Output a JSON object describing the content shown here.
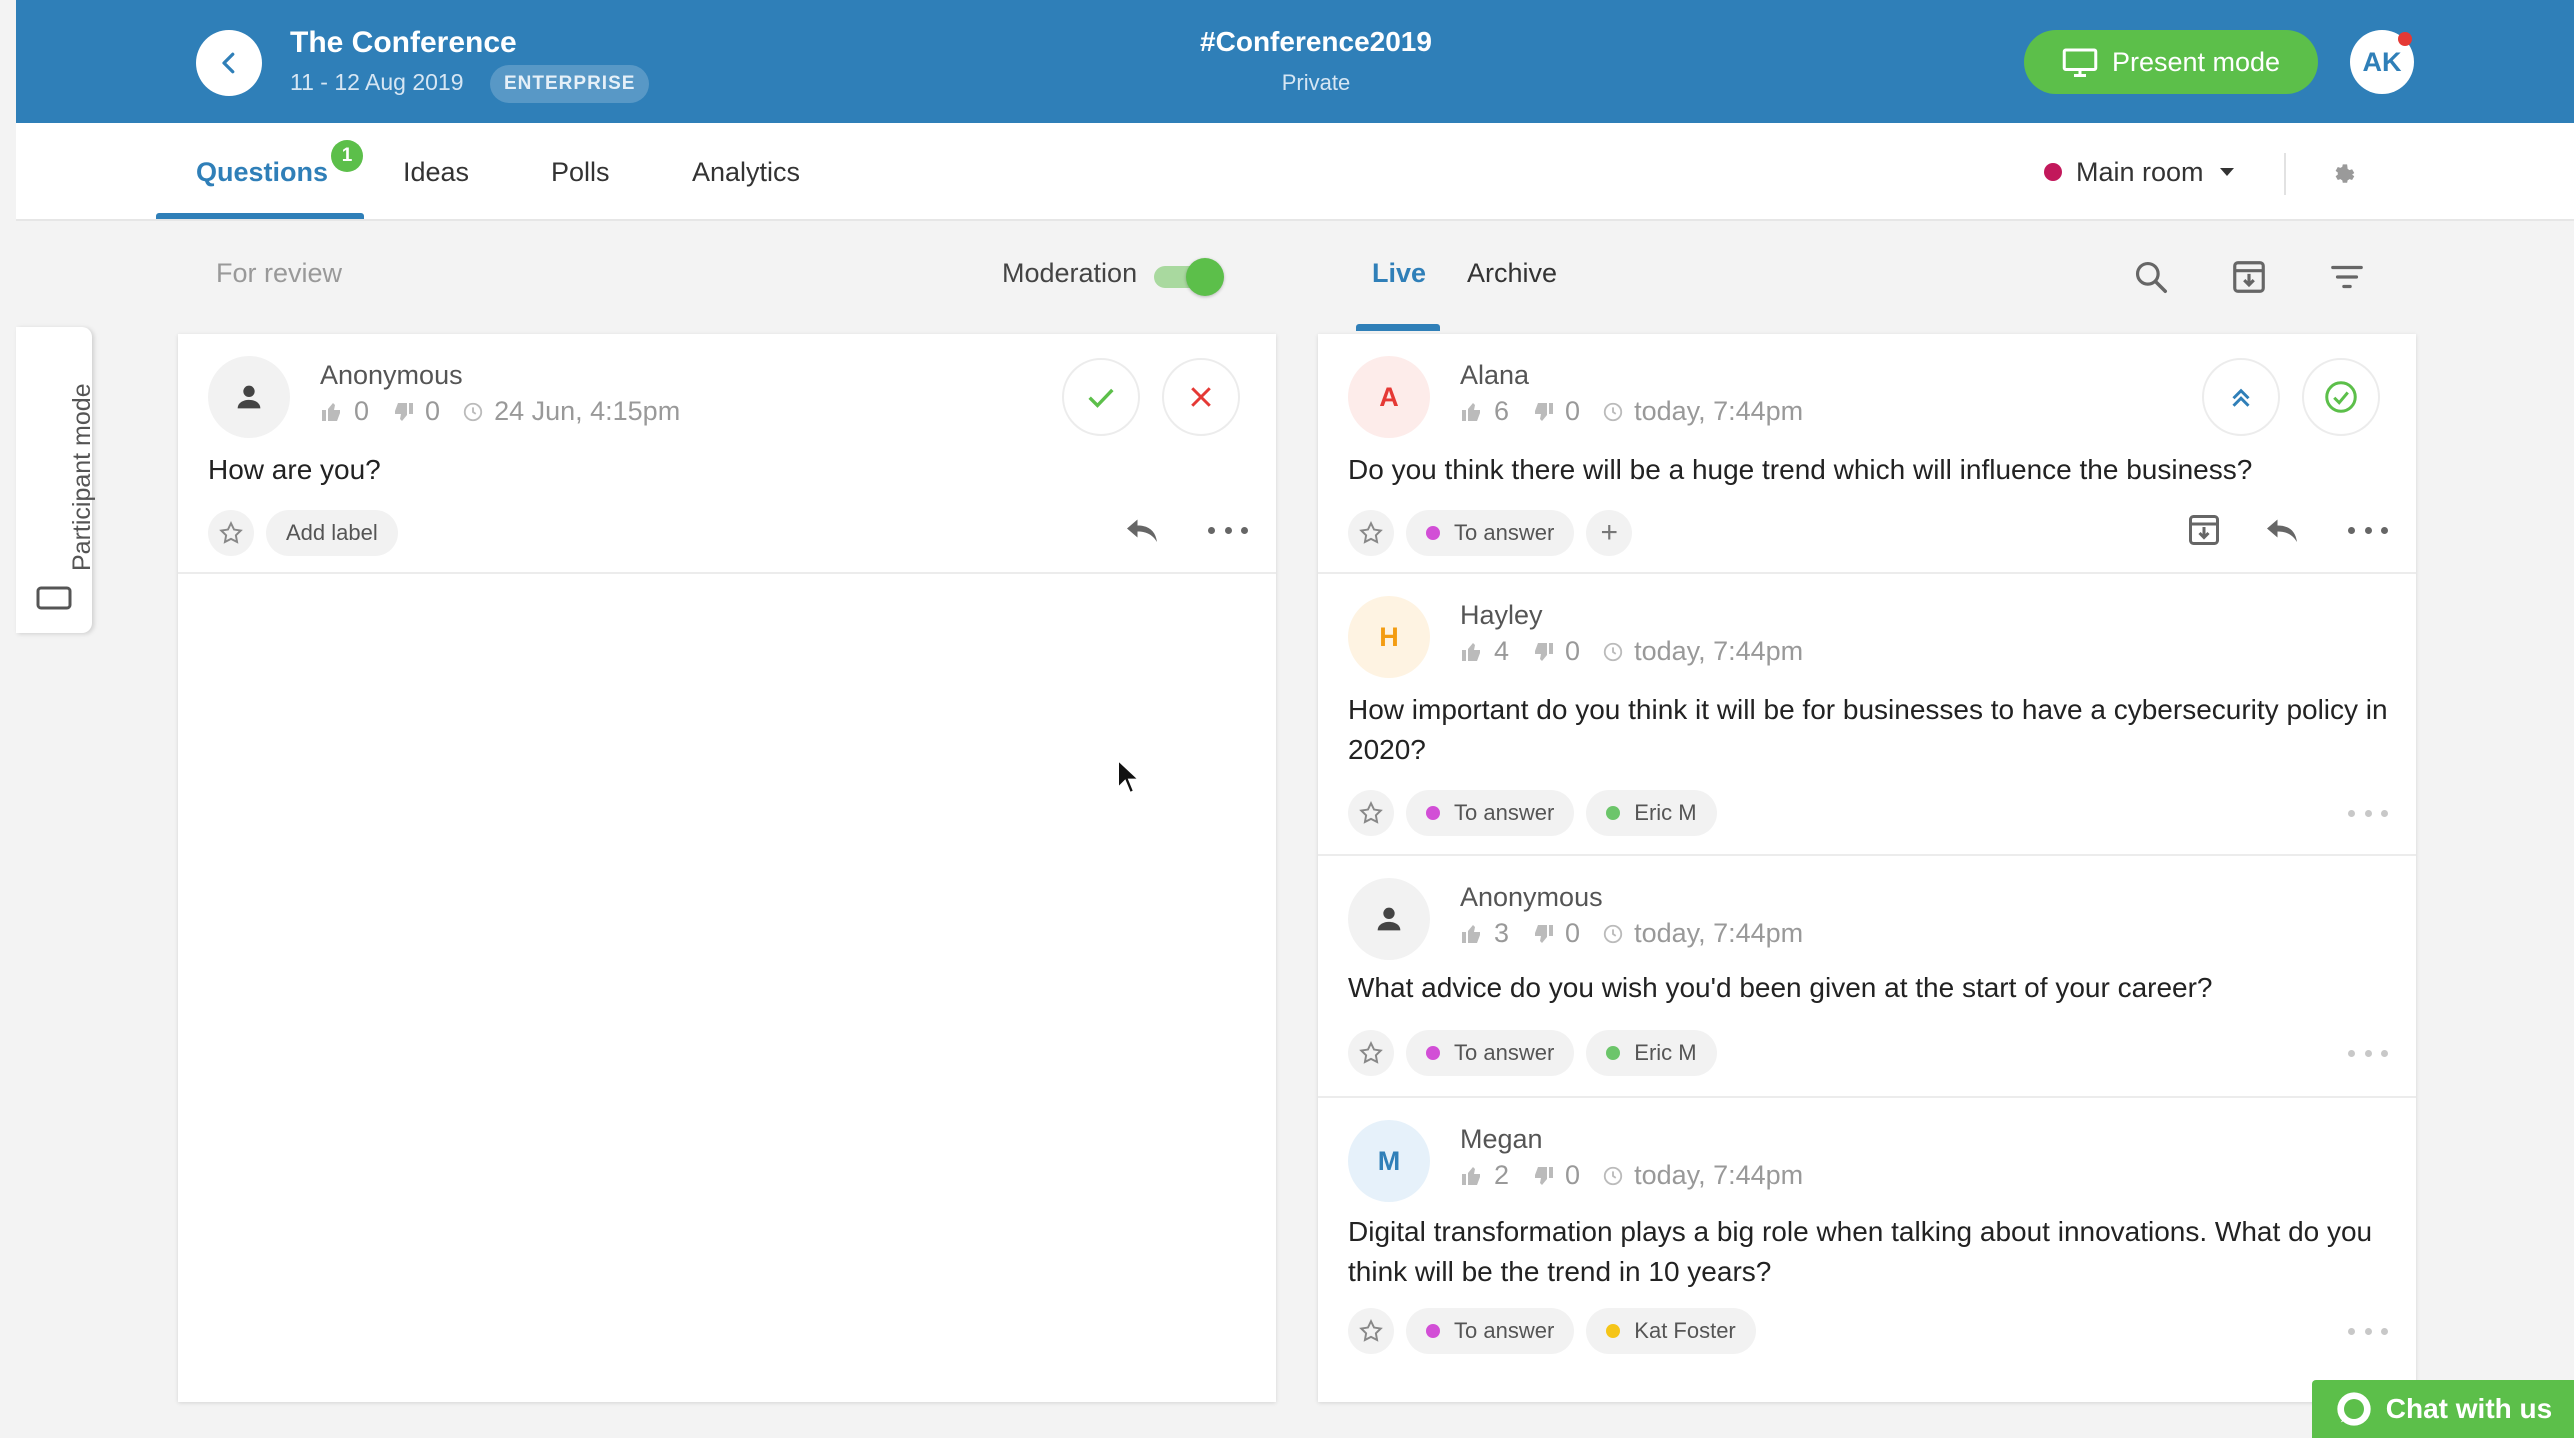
{
  "header": {
    "event_title": "The Conference",
    "event_dates": "11 - 12 Aug 2019",
    "plan_badge": "ENTERPRISE",
    "event_code": "#Conference2019",
    "privacy": "Private",
    "present_label": "Present mode",
    "user_initials": "AK"
  },
  "tabs": {
    "items": [
      {
        "label": "Questions",
        "active": true
      },
      {
        "label": "Ideas"
      },
      {
        "label": "Polls"
      },
      {
        "label": "Analytics"
      }
    ],
    "questions_count": "1",
    "room": "Main room"
  },
  "side_tab": {
    "label": "Participant mode"
  },
  "review": {
    "title": "For review",
    "moderation_label": "Moderation",
    "moderation_on": true,
    "questions": [
      {
        "author": "Anonymous",
        "likes": "0",
        "dislikes": "0",
        "time": "24 Jun, 4:15pm",
        "text": "How are you?",
        "add_label": "Add label"
      }
    ]
  },
  "live": {
    "tab_live": "Live",
    "tab_archive": "Archive",
    "questions": [
      {
        "initial": "A",
        "author": "Alana",
        "likes": "6",
        "dislikes": "0",
        "time": "today, 7:44pm",
        "text": "Do you think there will be a huge trend which will influence the business?",
        "status": "To answer",
        "assignee": ""
      },
      {
        "initial": "H",
        "author": "Hayley",
        "likes": "4",
        "dislikes": "0",
        "time": "today, 7:44pm",
        "text": "How important do you think it will be for businesses to have a cybersecurity policy in 2020?",
        "status": "To answer",
        "assignee": "Eric M"
      },
      {
        "initial": "",
        "author": "Anonymous",
        "likes": "3",
        "dislikes": "0",
        "time": "today, 7:44pm",
        "text": "What advice do you wish you'd been given at the start of your career?",
        "status": "To answer",
        "assignee": "Eric M"
      },
      {
        "initial": "M",
        "author": "Megan",
        "likes": "2",
        "dislikes": "0",
        "time": "today, 7:44pm",
        "text": "Digital transformation plays a big role when talking about innovations. What do you think will be the trend in 10 years?",
        "status": "To answer",
        "assignee": "Kat Foster"
      }
    ]
  },
  "chat": {
    "label": "Chat with us"
  },
  "colors": {
    "header_blue": "#2f7fb8",
    "accent_green": "#5cbf4a",
    "danger_red": "#e53935",
    "status_purple": "#d24fd6",
    "assignee_green": "#6cc56a",
    "assignee_yellow": "#f5c518",
    "room_dot": "#c2185b"
  },
  "icons": [
    "chevron-left-icon",
    "monitor-icon",
    "gear-icon",
    "caret-down-icon",
    "person-icon",
    "thumb-up-icon",
    "thumb-down-icon",
    "clock-icon",
    "check-icon",
    "close-icon",
    "star-icon",
    "reply-icon",
    "more-icon",
    "search-icon",
    "archive-icon",
    "filter-icon",
    "double-chevron-up-icon",
    "check-circle-icon",
    "chat-bubble-icon",
    "tablet-icon"
  ]
}
